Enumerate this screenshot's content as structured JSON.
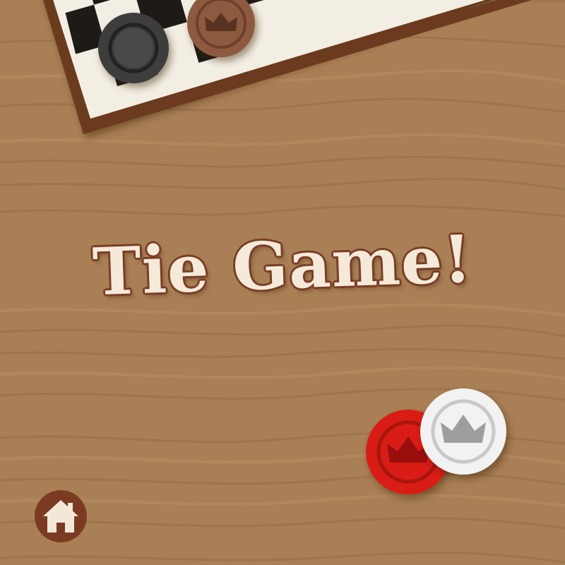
{
  "message": {
    "title": "Tie Game!"
  },
  "board": {
    "frame_color": "#6b3a1f",
    "dark_square": "#1e1a17",
    "light_square": "#f3eee3"
  },
  "table": {
    "wood_color": "#a97f55"
  },
  "pieces": [
    {
      "name": "black-checker",
      "color": "#3d3d3d",
      "king": false
    },
    {
      "name": "brown-king-checker",
      "color": "#8d5a3f",
      "king": true
    },
    {
      "name": "red-king-checker",
      "color": "#d91e18",
      "king": true
    },
    {
      "name": "white-king-checker",
      "color": "#f2f2f2",
      "king": true
    }
  ],
  "home_button": {
    "icon": "home-icon",
    "color": "#7a3b22"
  }
}
